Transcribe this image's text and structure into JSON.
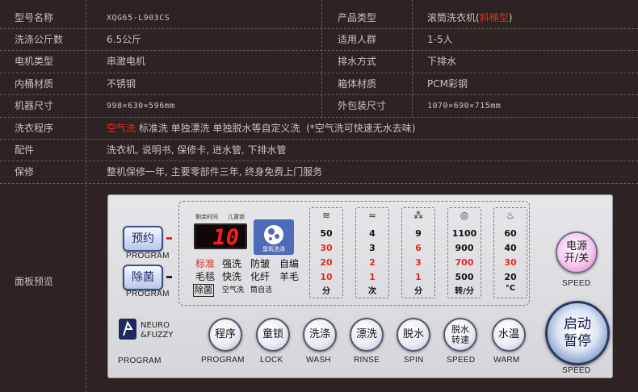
{
  "specs": [
    {
      "k1": "型号名称",
      "v1": "XQG65-L903CS",
      "v1_mono": true,
      "k2": "产品类型",
      "v2_pre": "滚筒洗衣机(",
      "v2_red": "斜桶型",
      "v2_post": ")"
    },
    {
      "k1": "洗涤公斤数",
      "v1": "6.5公斤",
      "k2": "适用人群",
      "v2": "1-5人"
    },
    {
      "k1": "电机类型",
      "v1": "串激电机",
      "k2": "排水方式",
      "v2": "下排水"
    },
    {
      "k1": "内桶材质",
      "v1": "不锈钢",
      "k2": "箱体材质",
      "v2": "PCM彩钢"
    },
    {
      "k1": "机器尺寸",
      "v1": "998×630×596mm",
      "v1_mono": true,
      "k2": "外包装尺寸",
      "v2": "1070×690×715mm",
      "v2_mono": true
    },
    {
      "k1": "洗衣程序",
      "v1_red": "空气洗",
      "v1": " 标准洗 单独漂洗 单独脱水等自定义洗  (*空气洗可快速无水去味)"
    },
    {
      "k1": "配件",
      "v1": "洗衣机, 说明书, 保修卡, 进水管, 下排水管"
    },
    {
      "k1": "保修",
      "v1": "整机保修一年, 主要零部件三年, 终身免费上门服务"
    }
  ],
  "panel_label": "面板预览",
  "panel": {
    "accent": "#e8281e",
    "left_buttons": {
      "reserve": "预约",
      "sterilize": "除菌",
      "program_caption": "PROGRAM"
    },
    "display": {
      "remaining_time_label": "剩余时间",
      "child_lock_label": "儿童锁",
      "digits": "10",
      "logo_text": "臭氧洗涤"
    },
    "programs": {
      "row1": [
        "标准",
        "强洗",
        "防皱",
        "自编"
      ],
      "row2": [
        "毛毯",
        "快洗",
        "化纤",
        "羊毛"
      ],
      "row3": [
        "除菌",
        "空气洗",
        "筒自洁"
      ]
    },
    "columns": [
      {
        "icon": "wash-time-icon",
        "values": [
          "50",
          "30",
          "20",
          "10"
        ],
        "unit": "分"
      },
      {
        "icon": "rinse-icon",
        "values": [
          "4",
          "3",
          "2",
          "1"
        ],
        "unit": "次"
      },
      {
        "icon": "spin-time-icon",
        "values": [
          "9",
          "6",
          "3",
          "1"
        ],
        "unit": "分"
      },
      {
        "icon": "speed-icon",
        "values": [
          "1100",
          "900",
          "700",
          "500"
        ],
        "unit": "转/分"
      },
      {
        "icon": "temperature-icon",
        "values": [
          "60",
          "40",
          "30",
          "20"
        ],
        "unit": "°C"
      }
    ],
    "power": {
      "line1": "电源",
      "line2": "开/关",
      "caption": "SPEED"
    },
    "brand": {
      "line1": "NEURO",
      "line2": "&FUZZY",
      "caption": "PROGRAM"
    },
    "round_buttons": [
      {
        "label": "程序",
        "caption": "PROGRAM"
      },
      {
        "label": "童锁",
        "caption": "LOCK"
      },
      {
        "label": "洗涤",
        "caption": "WASH"
      },
      {
        "label": "漂洗",
        "caption": "RINSE"
      },
      {
        "label": "脱水",
        "caption": "SPIN"
      },
      {
        "label1": "脱水",
        "label2": "转速",
        "caption": "SPEED"
      },
      {
        "label": "水温",
        "caption": "WARM"
      }
    ],
    "start": {
      "line1": "启动",
      "line2": "暂停",
      "caption": "SPEED"
    }
  }
}
